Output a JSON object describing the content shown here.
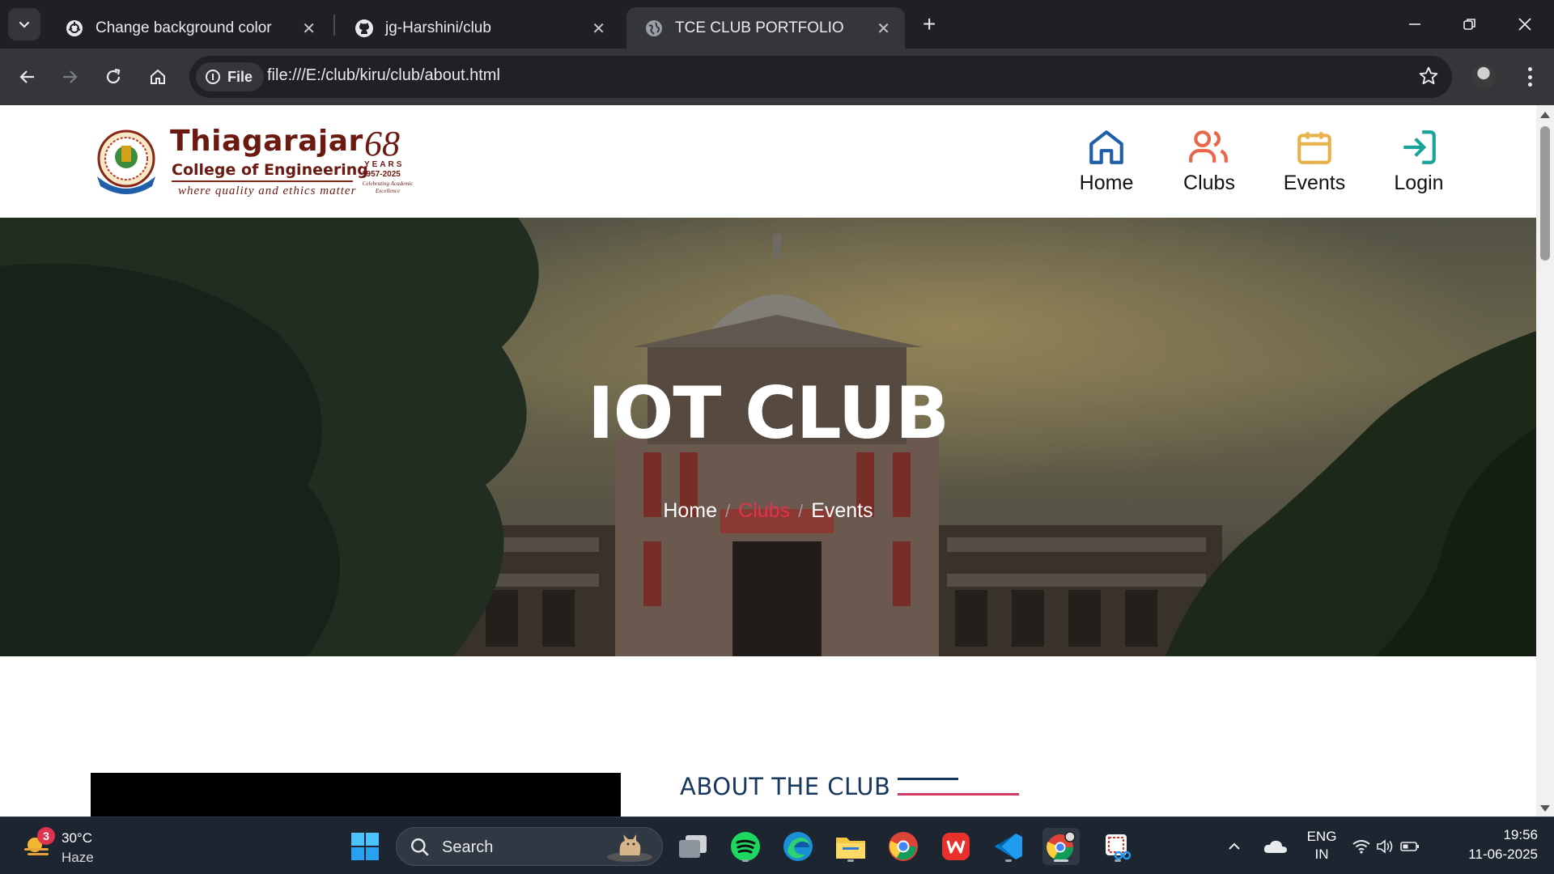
{
  "browser": {
    "tabs": [
      {
        "title": "Change background color",
        "icon": "chatgpt-icon",
        "active": false
      },
      {
        "title": "jg-Harshini/club",
        "icon": "github-icon",
        "active": false
      },
      {
        "title": "TCE CLUB PORTFOLIO",
        "icon": "globe-icon",
        "active": true
      }
    ],
    "site_chip": "File",
    "url": "file:///E:/club/kiru/club/about.html"
  },
  "site": {
    "logo": {
      "name": "Thiagarajar",
      "subtitle": "College of Engineering",
      "tagline": "where quality and ethics matter",
      "years_number": "68",
      "years_word": "YEARS",
      "years_range": "1957-2025",
      "celebrating": "Celebrating Academic Excellence"
    },
    "nav": [
      {
        "label": "Home",
        "icon": "home-icon",
        "color": "#1f5fa8"
      },
      {
        "label": "Clubs",
        "icon": "users-icon",
        "color": "#e8664a"
      },
      {
        "label": "Events",
        "icon": "calendar-icon",
        "color": "#e8b24a"
      },
      {
        "label": "Login",
        "icon": "login-icon",
        "color": "#1aa39a"
      }
    ],
    "hero": {
      "title": "IOT CLUB",
      "breadcrumbs": [
        {
          "label": "Home",
          "active": false
        },
        {
          "label": "Clubs",
          "active": true
        },
        {
          "label": "Events",
          "active": false
        }
      ]
    },
    "about": {
      "heading": "ABOUT THE CLUB"
    },
    "colors": {
      "accent_red": "#e0334f",
      "navy": "#17375e",
      "logo_maroon": "#6b1a12"
    }
  },
  "taskbar": {
    "weather": {
      "badge": "3",
      "temp": "30°C",
      "condition": "Haze"
    },
    "search_label": "Search",
    "apps": [
      "start-icon",
      "task-view-icon",
      "spotify-icon",
      "edge-icon",
      "file-explorer-icon",
      "chrome-icon",
      "wps-office-icon",
      "vscode-icon",
      "chrome-profile-icon",
      "snipping-tool-icon"
    ],
    "language": {
      "line1": "ENG",
      "line2": "IN"
    },
    "time": "19:56",
    "date": "11-06-2025"
  }
}
